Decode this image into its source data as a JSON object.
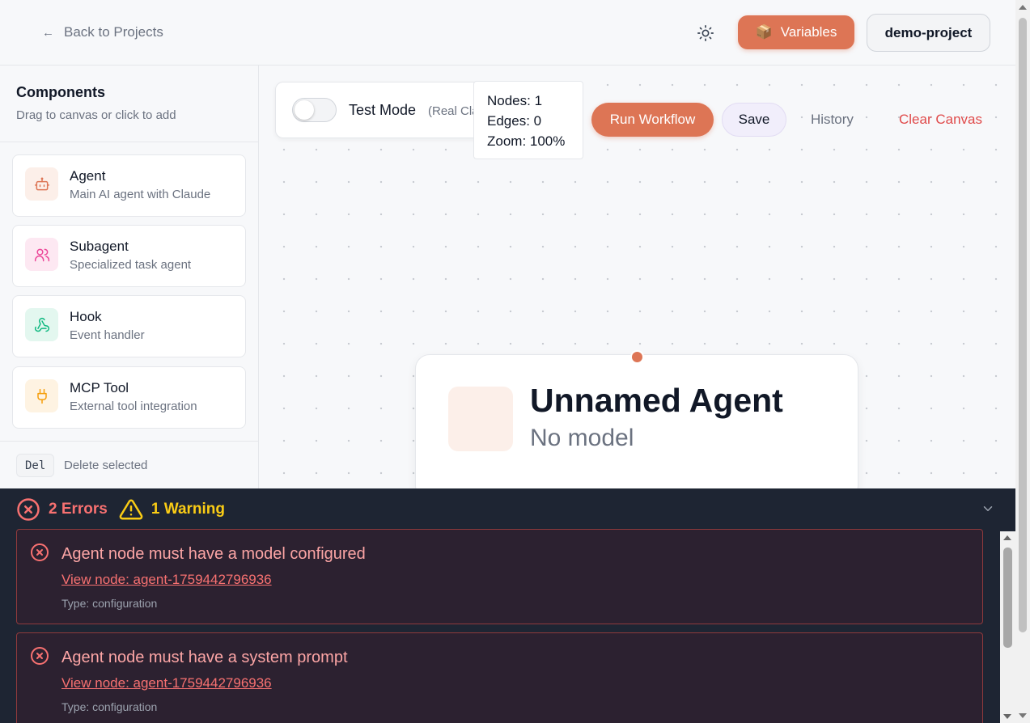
{
  "header": {
    "back_arrow": "←",
    "back_label": "Back to Projects",
    "theme_icon": "sun-icon",
    "variables_emoji": "📦",
    "variables_label": "Variables",
    "project_name": "demo-project"
  },
  "sidebar": {
    "title": "Components",
    "subtitle": "Drag to canvas or click to add",
    "items": [
      {
        "name": "Agent",
        "description": "Main AI agent with Claude",
        "icon": "bot-icon",
        "color": "#dd7555"
      },
      {
        "name": "Subagent",
        "description": "Specialized task agent",
        "icon": "users-icon",
        "color": "#ec4899"
      },
      {
        "name": "Hook",
        "description": "Event handler",
        "icon": "webhook-icon",
        "color": "#10b981"
      },
      {
        "name": "MCP Tool",
        "description": "External tool integration",
        "icon": "plug-icon",
        "color": "#f59e0b"
      }
    ],
    "shortcut_key": "Del",
    "shortcut_desc": "Delete selected"
  },
  "toolbar": {
    "test_mode_label": "Test Mode",
    "test_mode_sub": "(Real Cla",
    "test_mode_on": false,
    "stats": {
      "nodes": "Nodes: 1",
      "edges": "Edges: 0",
      "zoom": "Zoom: 100%"
    },
    "run_label": "Run Workflow",
    "save_label": "Save",
    "history_label": "History",
    "clear_label": "Clear Canvas"
  },
  "node": {
    "title": "Unnamed Agent",
    "model": "No model"
  },
  "errors_panel": {
    "errors_label": "2 Errors",
    "warnings_label": "1 Warning",
    "items": [
      {
        "message": "Agent node must have a model configured",
        "link": "View node: agent-1759442796936",
        "type": "Type: configuration"
      },
      {
        "message": "Agent node must have a system prompt",
        "link": "View node: agent-1759442796936",
        "type": "Type: configuration"
      }
    ]
  },
  "colors": {
    "accent": "#dd7555",
    "error": "#f87171",
    "warning": "#facc15",
    "panel_bg": "#1e2533"
  }
}
